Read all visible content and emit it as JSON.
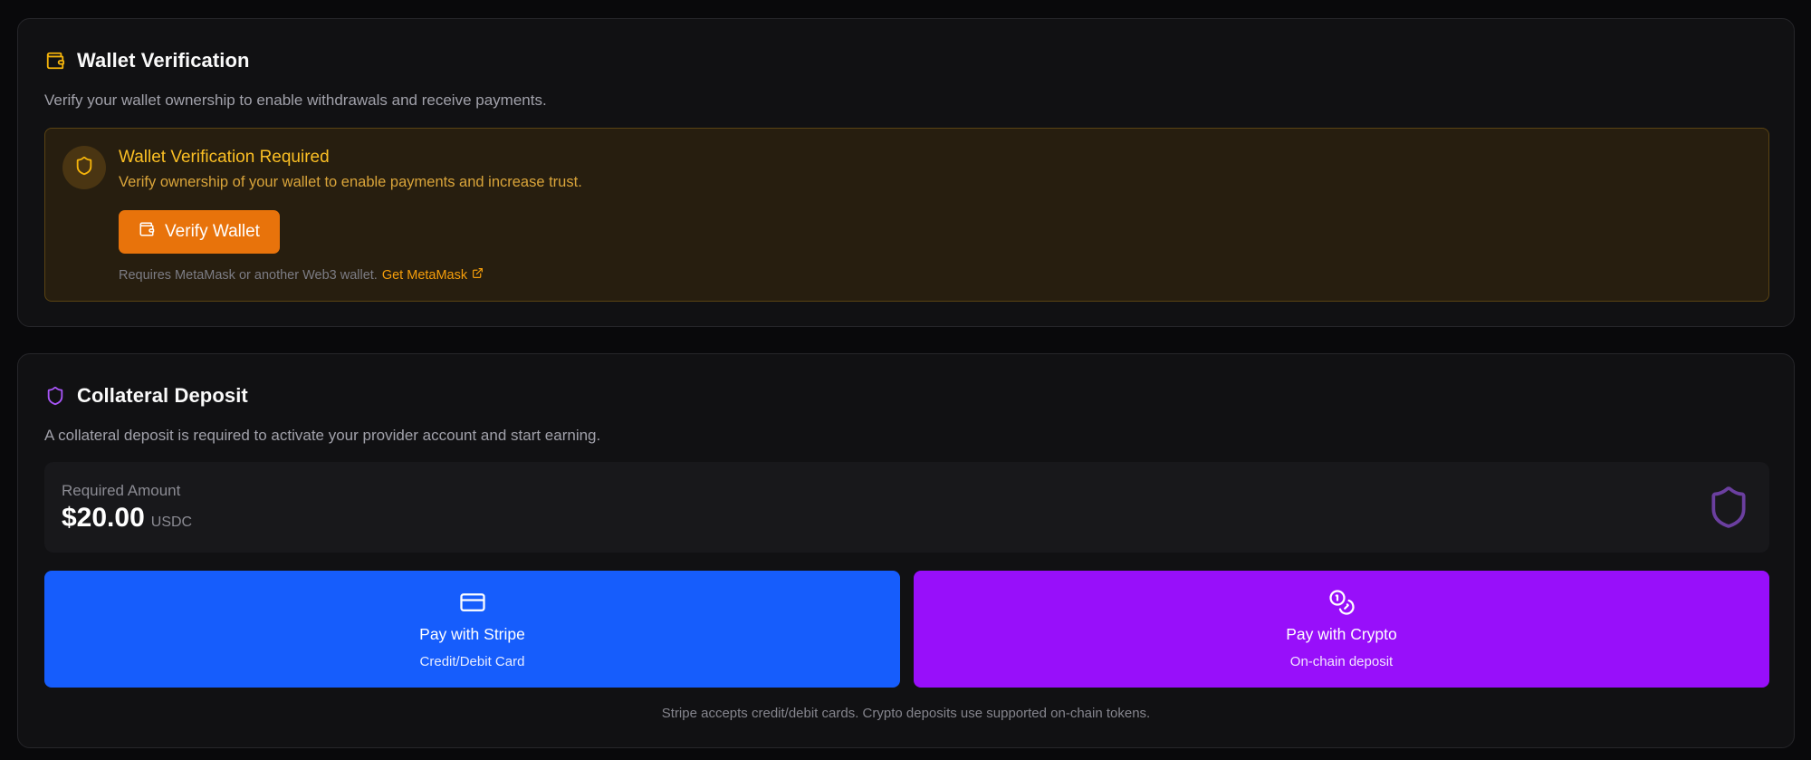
{
  "wallet_card": {
    "title": "Wallet Verification",
    "description": "Verify your wallet ownership to enable withdrawals and receive payments.",
    "title_icon": "wallet-icon",
    "alert": {
      "title": "Wallet Verification Required",
      "text": "Verify ownership of your wallet to enable payments and increase trust.",
      "icon": "shield-icon",
      "button_label": "Verify Wallet",
      "button_icon": "wallet-icon",
      "footer_text": "Requires MetaMask or another Web3 wallet.",
      "footer_link": "Get MetaMask",
      "footer_link_icon": "external-link-icon"
    }
  },
  "collateral_card": {
    "title": "Collateral Deposit",
    "title_icon": "shield-icon",
    "description": "A collateral deposit is required to activate your provider account and start earning.",
    "required": {
      "label": "Required Amount",
      "value": "$20.00",
      "unit": "USDC"
    },
    "pay_stripe": {
      "title": "Pay with Stripe",
      "subtitle": "Credit/Debit Card",
      "icon": "credit-card-icon"
    },
    "pay_crypto": {
      "title": "Pay with Crypto",
      "subtitle": "On-chain deposit",
      "icon": "coins-icon"
    },
    "footnote": "Stripe accepts credit/debit cards. Crypto deposits use supported on-chain tokens."
  },
  "colors": {
    "background": "#09090b",
    "card": "#111113",
    "amber_accent": "#fbbf24",
    "orange_button": "#e8730b",
    "stripe_blue": "#165dfc",
    "crypto_purple": "#980ffa",
    "violet_icon": "#a855f7"
  }
}
